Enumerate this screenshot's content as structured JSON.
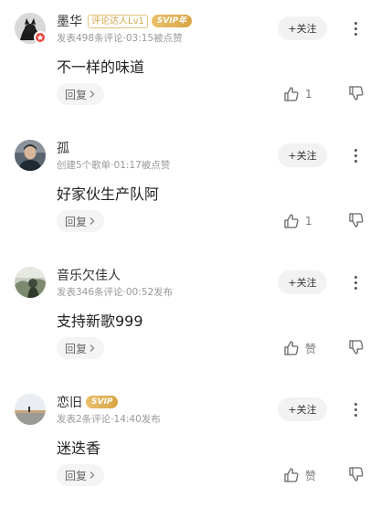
{
  "comments": [
    {
      "username": "墨华",
      "talent_badge": "评论达人Lv1",
      "svip_badge": "SVIP年",
      "meta": "发表498条评论·03:15被点赞",
      "content": "不一样的味道",
      "follow_label": "+关注",
      "reply_label": "回复",
      "like_count": "1",
      "avatar_icon": "avatar-cat-icon",
      "has_vip_dot": true
    },
    {
      "username": "孤",
      "meta": "创建5个歌单·01:17被点赞",
      "content": "好家伙生产队阿",
      "follow_label": "+关注",
      "reply_label": "回复",
      "like_count": "1",
      "avatar_icon": "avatar-person-icon"
    },
    {
      "username": "音乐欠佳人",
      "meta": "发表346条评论·00:52发布",
      "content": "支持新歌999",
      "follow_label": "+关注",
      "reply_label": "回复",
      "like_count": "赞",
      "avatar_icon": "avatar-scene-icon"
    },
    {
      "username": "恋旧",
      "svip_badge": "SVIP",
      "meta": "发表2条评论·14:40发布",
      "content": "迷迭香",
      "follow_label": "+关注",
      "reply_label": "回复",
      "like_count": "赞",
      "avatar_icon": "avatar-sunset-icon"
    }
  ],
  "colors": {
    "vip_gold": "#d9a544",
    "vip_red": "#e8453c",
    "muted": "#999999"
  }
}
